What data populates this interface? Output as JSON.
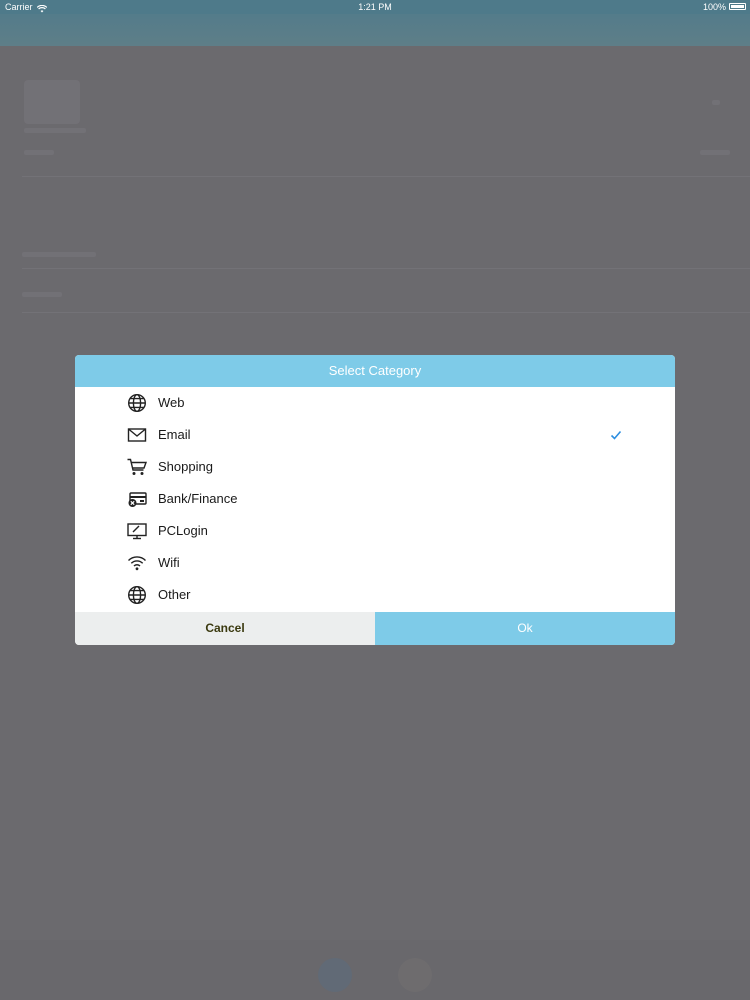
{
  "status_bar": {
    "carrier": "Carrier",
    "time": "1:21 PM",
    "battery": "100%"
  },
  "dialog": {
    "title": "Select Category",
    "items": [
      {
        "label": "Web",
        "icon": "globe-icon",
        "selected": false
      },
      {
        "label": "Email",
        "icon": "envelope-icon",
        "selected": true
      },
      {
        "label": "Shopping",
        "icon": "shopping-cart-icon",
        "selected": false
      },
      {
        "label": "Bank/Finance",
        "icon": "credit-card-icon",
        "selected": false
      },
      {
        "label": "PCLogin",
        "icon": "monitor-icon",
        "selected": false
      },
      {
        "label": "Wifi",
        "icon": "wifi-icon",
        "selected": false
      },
      {
        "label": "Other",
        "icon": "globe-icon",
        "selected": false
      }
    ],
    "cancel_label": "Cancel",
    "ok_label": "Ok"
  },
  "colors": {
    "accent": "#7ecbe8",
    "overlay": "#6b6a6e",
    "check": "#2c8ee0"
  }
}
